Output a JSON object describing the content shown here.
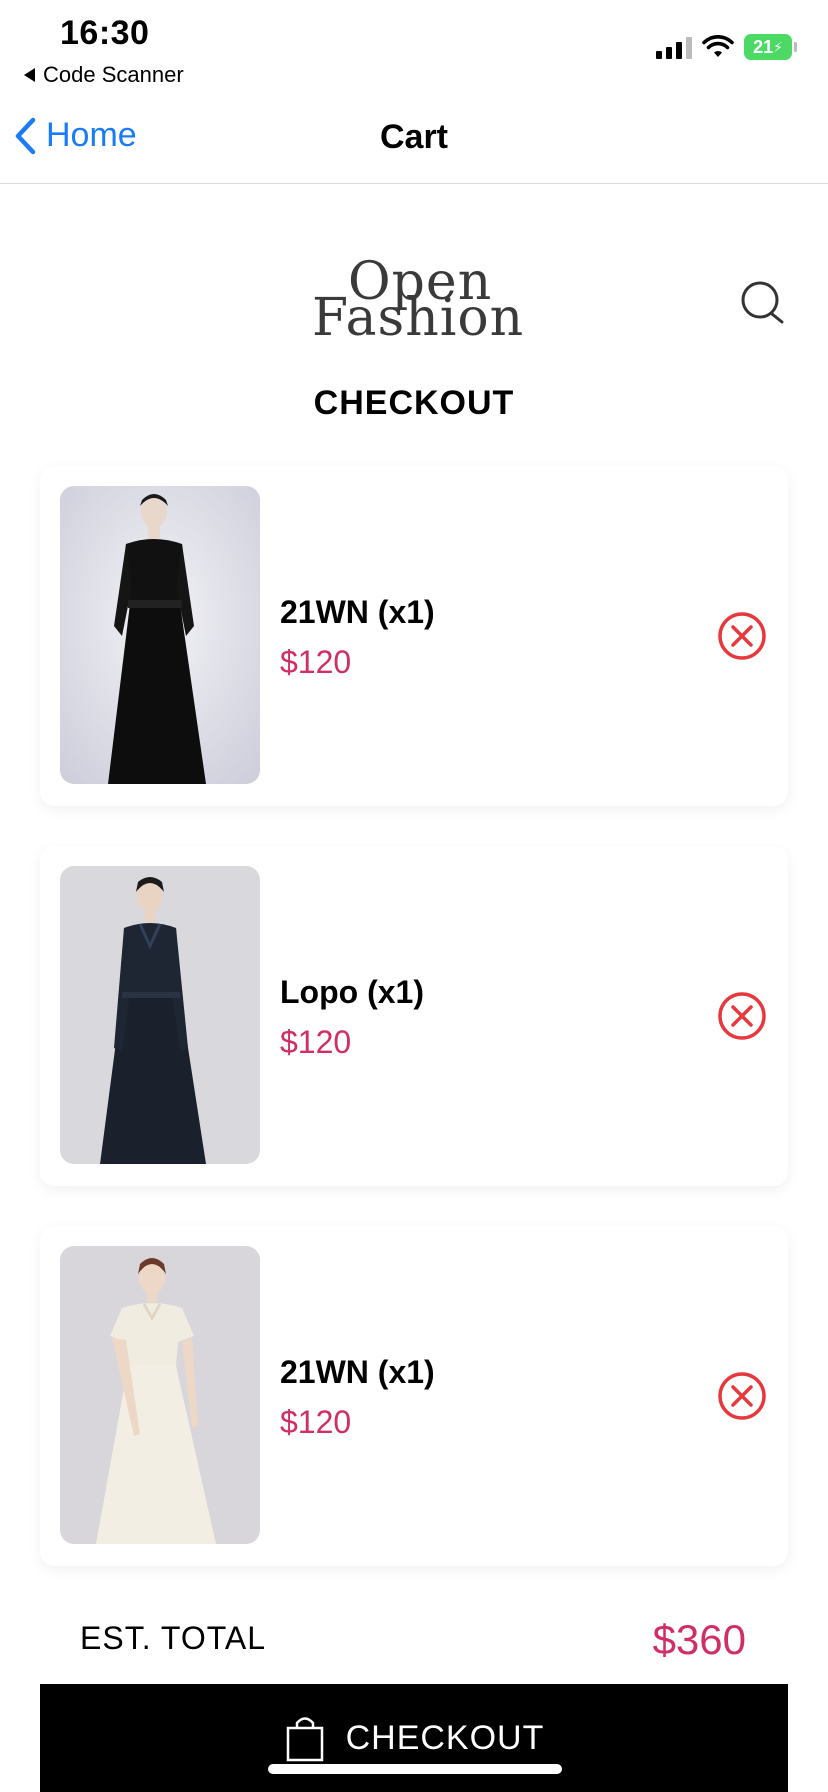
{
  "status_bar": {
    "time": "16:30",
    "back_app": "Code Scanner",
    "battery": "21"
  },
  "nav": {
    "back_label": "Home",
    "title": "Cart"
  },
  "header": {
    "logo_line1": "Open",
    "logo_line2": "Fashion",
    "page_title": "CHECKOUT",
    "search_icon": "search-icon"
  },
  "cart_items": [
    {
      "name": "21WN (x1)",
      "price": "$120",
      "image": "black-dress-photo"
    },
    {
      "name": "Lopo (x1)",
      "price": "$120",
      "image": "navy-coat-dress-photo"
    },
    {
      "name": "21WN (x1)",
      "price": "$120",
      "image": "cream-dress-photo"
    }
  ],
  "total": {
    "label": "EST. TOTAL",
    "value": "$360"
  },
  "checkout_button": {
    "label": "CHECKOUT",
    "icon": "shopping-bag-icon"
  },
  "colors": {
    "accent": "#d12e68",
    "link": "#1a7cf5",
    "remove": "#e8383d",
    "button_bg": "#000000"
  }
}
